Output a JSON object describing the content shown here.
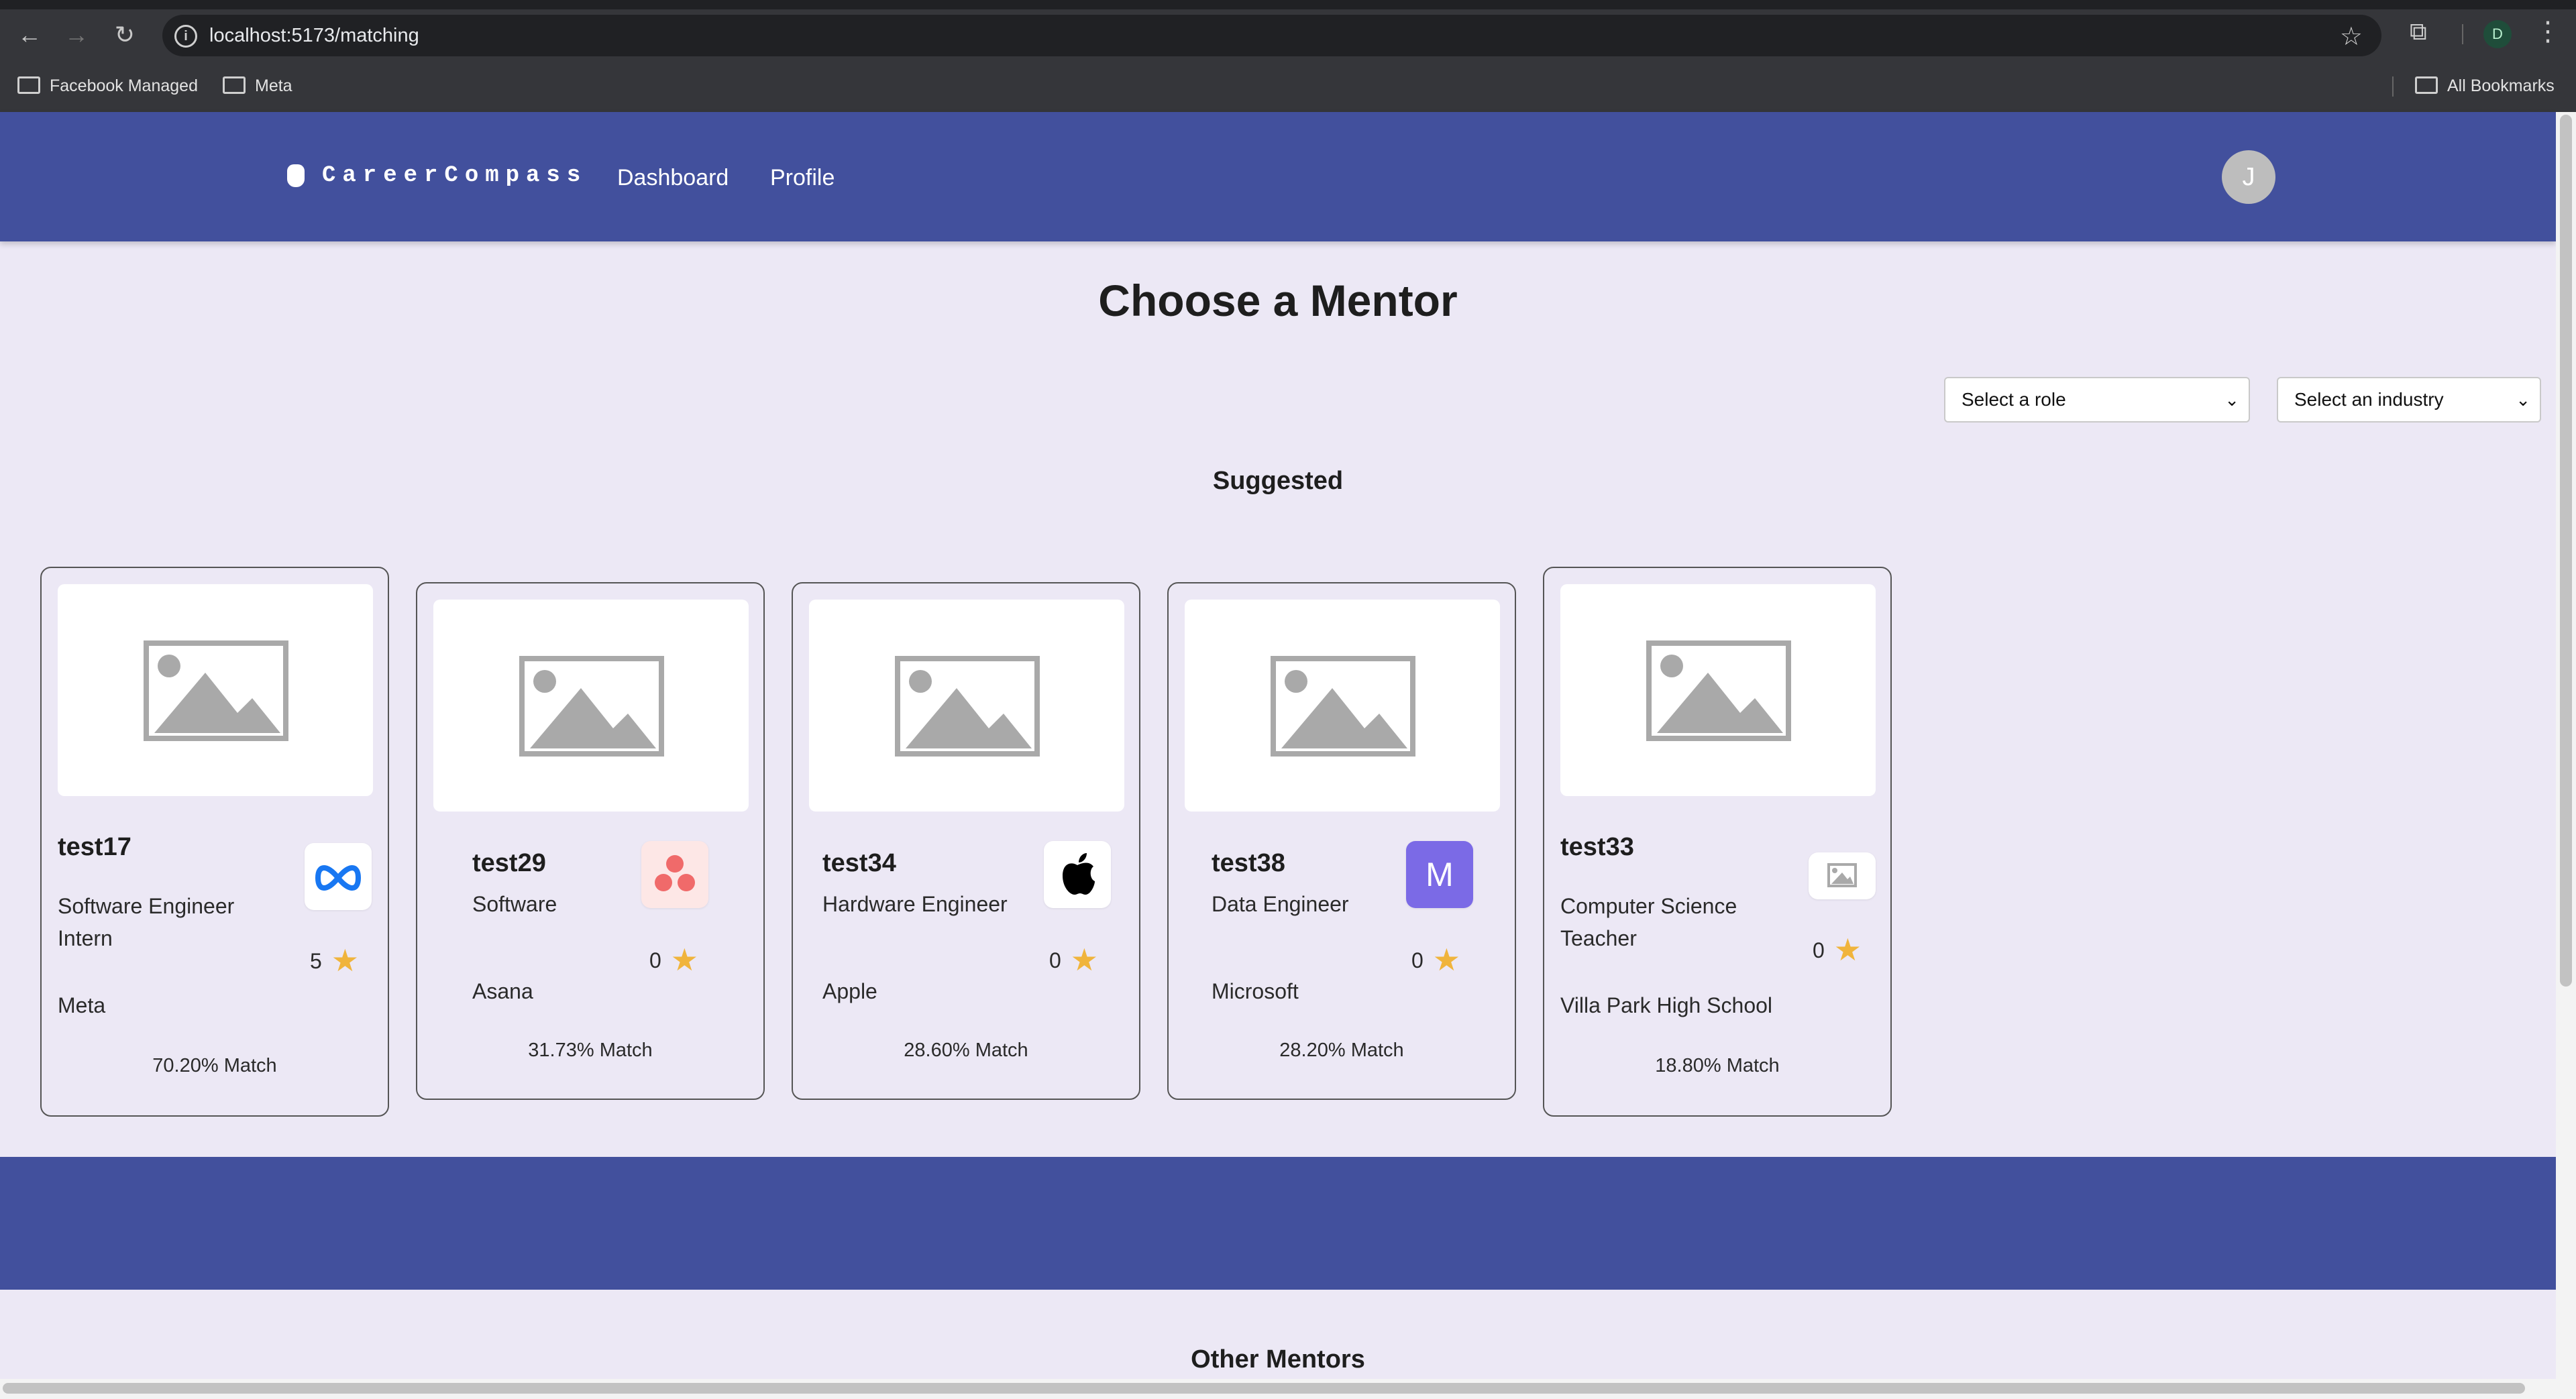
{
  "browser": {
    "url": "localhost:5173/matching",
    "bookmarks": [
      {
        "label": "Facebook Managed"
      },
      {
        "label": "Meta"
      }
    ],
    "all_bookmarks_label": "All Bookmarks",
    "profile_initial": "D"
  },
  "app": {
    "brand": "CareerCompass",
    "nav": [
      "Dashboard",
      "Profile"
    ],
    "avatar_initial": "J"
  },
  "page": {
    "title": "Choose a Mentor",
    "role_select": "Select a role",
    "industry_select": "Select an industry",
    "suggested_label": "Suggested",
    "other_label": "Other Mentors"
  },
  "mentors": [
    {
      "name": "test17",
      "role": "Software Engineer Intern",
      "company": "Meta",
      "rating": "5",
      "match": "70.20% Match",
      "logo": "meta-logo-icon"
    },
    {
      "name": "test29",
      "role": "Software",
      "company": "Asana",
      "rating": "0",
      "match": "31.73% Match",
      "logo": "asana-logo-icon"
    },
    {
      "name": "test34",
      "role": "Hardware Engineer",
      "company": "Apple",
      "rating": "0",
      "match": "28.60% Match",
      "logo": "apple-logo-icon"
    },
    {
      "name": "test38",
      "role": "Data Engineer",
      "company": "Microsoft",
      "rating": "0",
      "match": "28.20% Match",
      "logo": "letter-m-logo-icon",
      "logo_letter": "M"
    },
    {
      "name": "test33",
      "role": "Computer Science Teacher",
      "company": "Villa Park High School",
      "rating": "0",
      "match": "18.80% Match",
      "logo": "image-placeholder-icon"
    }
  ],
  "colors": {
    "appbar": "#42509d",
    "background": "#ece8f5",
    "star": "#f0b43c",
    "microsoft_tile": "#7b6ae6"
  }
}
